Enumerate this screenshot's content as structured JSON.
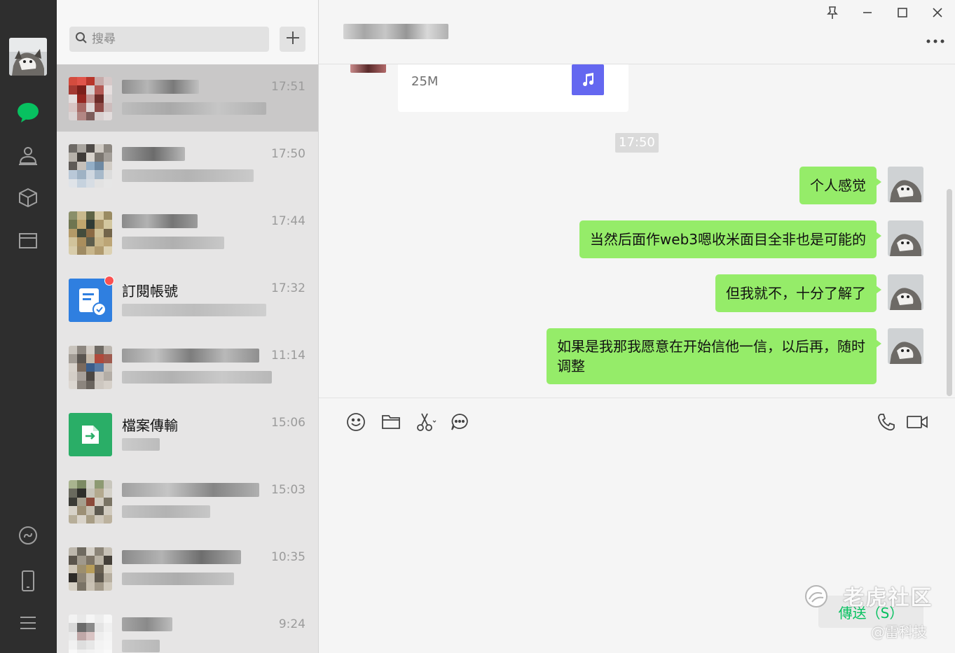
{
  "rail": {
    "avatar_icon": "profile-avatar",
    "items": [
      {
        "name": "chats",
        "icon": "chat-bubble-icon",
        "active": true
      },
      {
        "name": "contacts",
        "icon": "contacts-icon"
      },
      {
        "name": "favorites",
        "icon": "cube-icon"
      },
      {
        "name": "files",
        "icon": "folder-icon"
      }
    ],
    "bottom": [
      {
        "name": "mini-programs",
        "icon": "mini-program-icon"
      },
      {
        "name": "phone",
        "icon": "phone-device-icon"
      },
      {
        "name": "menu",
        "icon": "hamburger-icon"
      }
    ]
  },
  "search": {
    "placeholder": "搜尋"
  },
  "chats": [
    {
      "name": "",
      "time": "17:51",
      "active": true
    },
    {
      "name": "",
      "time": "17:50"
    },
    {
      "name": "",
      "time": "17:44"
    },
    {
      "name": "訂閱帳號",
      "time": "17:32",
      "badge": true
    },
    {
      "name": "",
      "time": "11:14"
    },
    {
      "name": "檔案傳輸",
      "time": "15:06"
    },
    {
      "name": "",
      "time": "15:03"
    },
    {
      "name": "",
      "time": "10:35"
    },
    {
      "name": "",
      "time": "9:24"
    }
  ],
  "conversation": {
    "file": {
      "size": "25M",
      "icon": "music-note-icon"
    },
    "timestamp": "17:50",
    "messages": [
      {
        "text": "个人感觉"
      },
      {
        "text": "当然后面作web3嗯收米面目全非也是可能的"
      },
      {
        "text": "但我就不，十分了解了"
      },
      {
        "text": "如果是我那我愿意在开始信他一信，以后再，随时调整"
      }
    ]
  },
  "composer": {
    "tools": [
      "emoji-icon",
      "folder-icon",
      "scissors-icon",
      "chat-history-icon",
      "voice-call-icon",
      "video-call-icon"
    ],
    "send_label": "傳送（S）"
  },
  "watermark": {
    "line1": "老虎社区",
    "line2": "@雷科技"
  },
  "colors": {
    "accent": "#07c160",
    "bubble": "#95ec69",
    "rail": "#2e2e2e"
  }
}
